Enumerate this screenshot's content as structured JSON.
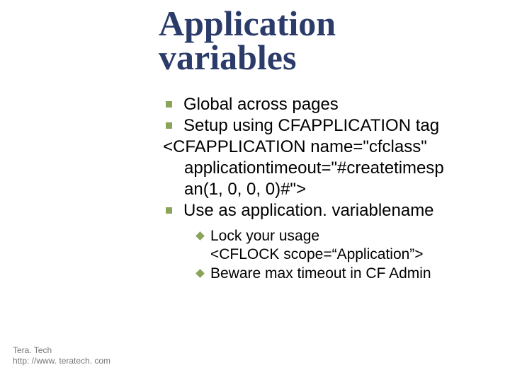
{
  "title": "Application variables",
  "bullets": {
    "b1": "Global across pages",
    "b2": "Setup using CFAPPLICATION tag",
    "code1": "<CFAPPLICATION name=\"cfclass\"",
    "code2": "applicationtimeout=\"#createtimesp",
    "code3": "an(1, 0, 0, 0)#\">",
    "b3": "Use as application. variablename"
  },
  "sub": {
    "s1a": "Lock your usage",
    "s1b": "<CFLOCK scope=“Application”>",
    "s2": "Beware max timeout in CF Admin"
  },
  "footer": {
    "line1": "Tera. Tech",
    "line2": "http: //www. teratech. com"
  }
}
